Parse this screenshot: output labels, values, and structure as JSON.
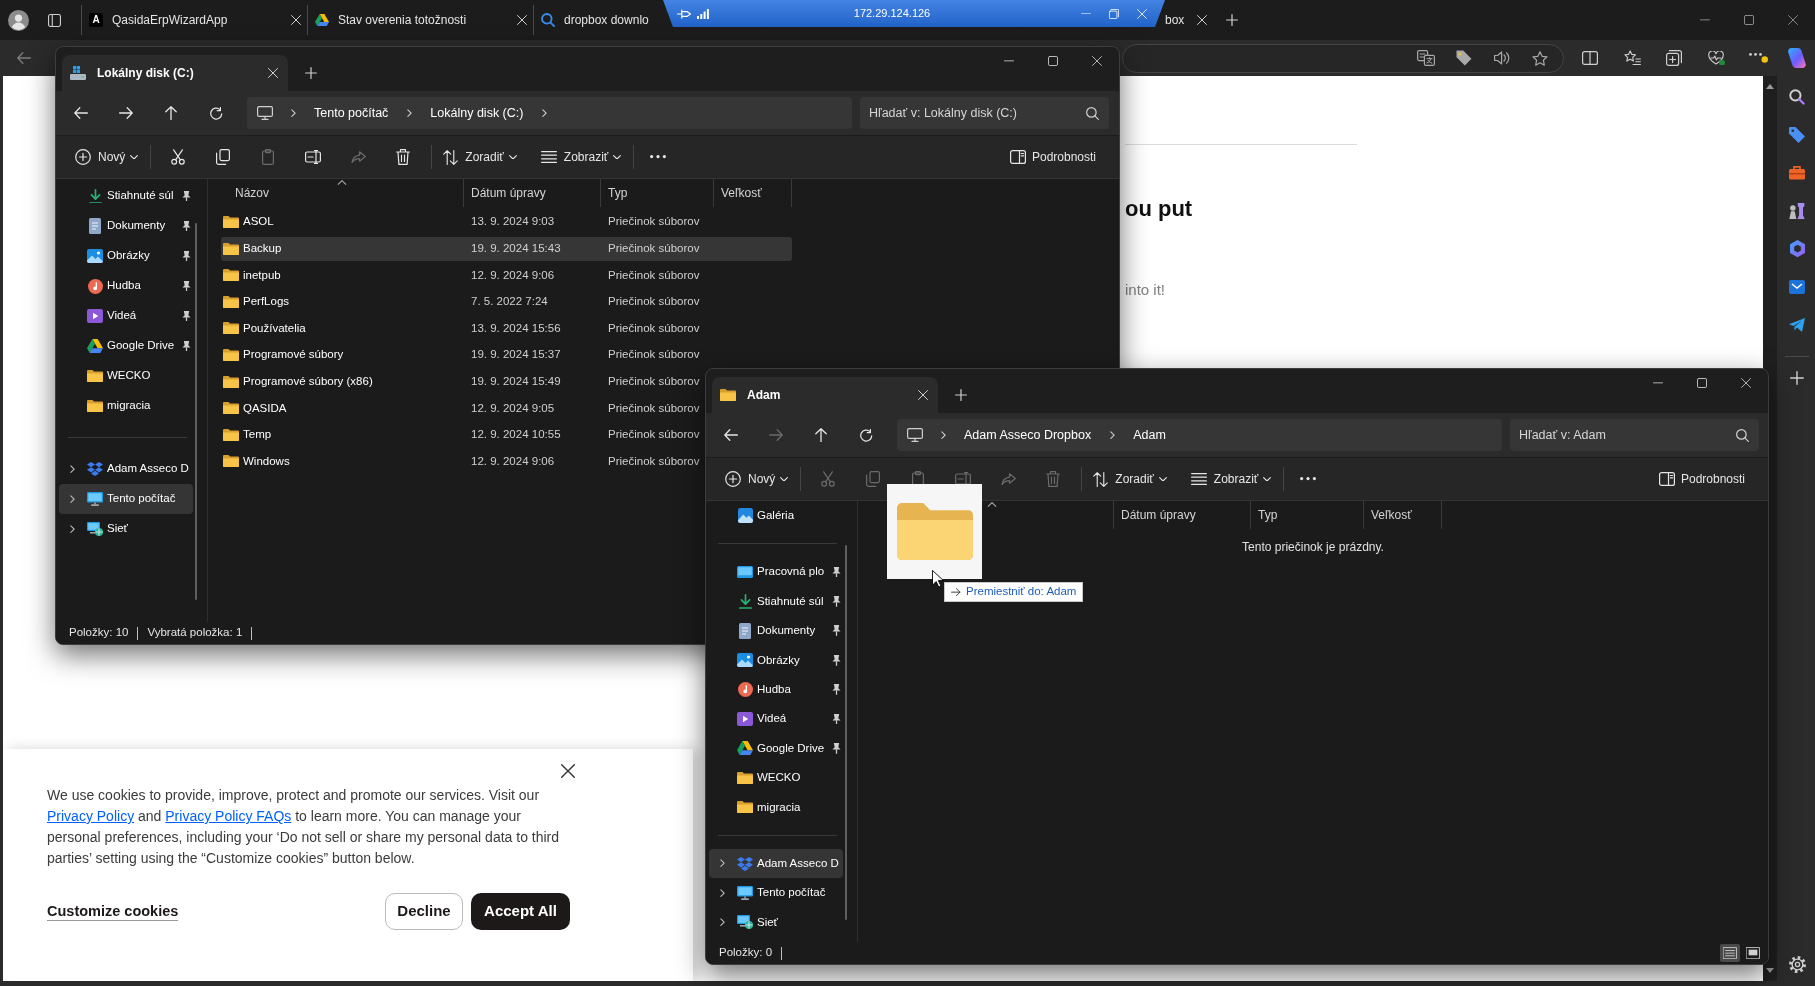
{
  "browser": {
    "tabs": [
      {
        "kind": "tab",
        "title": "QasidaErpWizardApp",
        "favicon": {
          "kind": "letter",
          "text": "A"
        }
      },
      {
        "kind": "tab",
        "title": "Stav overenia totožnosti",
        "favicon": {
          "kind": "google-drive"
        }
      },
      {
        "kind": "head",
        "title": "dropbox downlo",
        "favicon": {
          "kind": "search"
        }
      },
      {
        "kind": "tail",
        "title": "box"
      }
    ],
    "remote_bar": {
      "title": "172.29.124.126"
    },
    "page": {
      "heading": "ou put",
      "text": "into it!"
    },
    "cookie_banner": {
      "message": [
        {
          "kind": "text",
          "text": "We use cookies to provide, improve, protect and promote our services. Visit our "
        },
        {
          "kind": "link",
          "text": "Privacy Policy"
        },
        {
          "kind": "text",
          "text": " and "
        },
        {
          "kind": "link",
          "text": "Privacy Policy FAQs"
        },
        {
          "kind": "text",
          "text": " to learn more. You can manage your personal preferences, including your ‘Do not sell or share my personal data to third parties’ setting using the “Customize cookies” button below."
        }
      ],
      "customize": "Customize cookies",
      "decline": "Decline",
      "accept": "Accept All"
    }
  },
  "explorer_windows": [
    {
      "tab": {
        "title": "Lokálny disk (C:)",
        "kind": "drive"
      },
      "nav": [
        {
          "kind": "back",
          "disabled": false
        },
        {
          "kind": "forward",
          "disabled": false
        },
        {
          "kind": "up",
          "disabled": false
        },
        {
          "kind": "refresh",
          "disabled": false
        }
      ],
      "address": {
        "crumbs": [
          "Tento počítač",
          "Lokálny disk (C:)"
        ],
        "trailing_chevron": true
      },
      "search": {
        "placeholder": "Hľadať v: Lokálny disk (C:)"
      },
      "toolbar": [
        {
          "kind": "new",
          "label": "Nový",
          "disabled": false
        },
        {
          "kind": "cut",
          "disabled": false
        },
        {
          "kind": "copy",
          "disabled": false
        },
        {
          "kind": "paste",
          "disabled": true
        },
        {
          "kind": "rename",
          "disabled": false
        },
        {
          "kind": "share",
          "disabled": true
        },
        {
          "kind": "delete",
          "disabled": false
        },
        {
          "kind": "sort",
          "label": "Zoradiť",
          "disabled": false
        },
        {
          "kind": "view",
          "label": "Zobraziť",
          "disabled": false
        },
        {
          "kind": "more",
          "disabled": false
        },
        {
          "kind": "details",
          "label": "Podrobnosti",
          "disabled": false
        }
      ],
      "sidebar": [
        [
          {
            "label": "Stiahnuté súl",
            "kind": "download",
            "pinned": true,
            "selected": false
          },
          {
            "label": "Dokumenty",
            "kind": "documents",
            "pinned": true,
            "selected": false
          },
          {
            "label": "Obrázky",
            "kind": "pictures",
            "pinned": true,
            "selected": false
          },
          {
            "label": "Hudba",
            "kind": "music",
            "pinned": true,
            "selected": false
          },
          {
            "label": "Videá",
            "kind": "videos",
            "pinned": true,
            "selected": false
          },
          {
            "label": "Google Drive",
            "kind": "google-drive",
            "pinned": true,
            "selected": false
          },
          {
            "label": "WECKO",
            "kind": "folder",
            "pinned": false,
            "selected": false
          },
          {
            "label": "migracia",
            "kind": "folder",
            "pinned": false,
            "selected": false
          }
        ],
        [
          {
            "label": "Adam Asseco D",
            "kind": "dropbox",
            "expanded": false,
            "pinned": false,
            "selected": false
          },
          {
            "label": "Tento počítač",
            "kind": "computer",
            "expanded": false,
            "pinned": false,
            "selected": true
          },
          {
            "label": "Sieť",
            "kind": "network",
            "expanded": false,
            "pinned": false,
            "selected": false
          }
        ]
      ],
      "columns": [
        {
          "label": "Názov",
          "sorted": true
        },
        {
          "label": "Dátum úpravy",
          "sorted": false
        },
        {
          "label": "Typ",
          "sorted": false
        },
        {
          "label": "Veľkosť",
          "sorted": false
        }
      ],
      "rows": [
        {
          "name": "ASOL",
          "modified": "13. 9. 2024 9:03",
          "type": "Priečinok súborov",
          "selected": false
        },
        {
          "name": "Backup",
          "modified": "19. 9. 2024 15:43",
          "type": "Priečinok súborov",
          "selected": true
        },
        {
          "name": "inetpub",
          "modified": "12. 9. 2024 9:06",
          "type": "Priečinok súborov",
          "selected": false
        },
        {
          "name": "PerfLogs",
          "modified": "7. 5. 2022 7:24",
          "type": "Priečinok súborov",
          "selected": false
        },
        {
          "name": "Používatelia",
          "modified": "13. 9. 2024 15:56",
          "type": "Priečinok súborov",
          "selected": false
        },
        {
          "name": "Programové súbory",
          "modified": "19. 9. 2024 15:37",
          "type": "Priečinok súborov",
          "selected": false
        },
        {
          "name": "Programové súbory (x86)",
          "modified": "19. 9. 2024 15:49",
          "type": "Priečinok súborov",
          "selected": false
        },
        {
          "name": "QASIDA",
          "modified": "12. 9. 2024 9:05",
          "type": "Priečinok súborov",
          "selected": false
        },
        {
          "name": "Temp",
          "modified": "12. 9. 2024 10:55",
          "type": "Priečinok súborov",
          "selected": false
        },
        {
          "name": "Windows",
          "modified": "12. 9. 2024 9:06",
          "type": "Priečinok súborov",
          "selected": false
        }
      ],
      "status": [
        "Položky: 10",
        "Vybratá položka: 1"
      ]
    },
    {
      "tab": {
        "title": "Adam",
        "kind": "folder"
      },
      "nav": [
        {
          "kind": "back",
          "disabled": false
        },
        {
          "kind": "forward",
          "disabled": true
        },
        {
          "kind": "up",
          "disabled": false
        },
        {
          "kind": "refresh",
          "disabled": false
        }
      ],
      "address": {
        "crumbs": [
          "Adam Asseco Dropbox",
          "Adam"
        ],
        "trailing_chevron": false
      },
      "search": {
        "placeholder": "Hľadať v: Adam"
      },
      "toolbar": [
        {
          "kind": "new",
          "label": "Nový",
          "disabled": false
        },
        {
          "kind": "cut",
          "disabled": true
        },
        {
          "kind": "copy",
          "disabled": true
        },
        {
          "kind": "paste",
          "disabled": true
        },
        {
          "kind": "rename",
          "disabled": true
        },
        {
          "kind": "share",
          "disabled": true
        },
        {
          "kind": "delete",
          "disabled": true
        },
        {
          "kind": "sort",
          "label": "Zoradiť",
          "disabled": false
        },
        {
          "kind": "view",
          "label": "Zobraziť",
          "disabled": false
        },
        {
          "kind": "more",
          "disabled": false
        },
        {
          "kind": "details",
          "label": "Podrobnosti",
          "disabled": false
        }
      ],
      "sidebar": [
        [
          {
            "label": "Galéria",
            "kind": "gallery",
            "pinned": false,
            "selected": false
          }
        ],
        [
          {
            "label": "Pracovná plo",
            "kind": "desktop",
            "pinned": true,
            "selected": false
          },
          {
            "label": "Stiahnuté súl",
            "kind": "download",
            "pinned": true,
            "selected": false
          },
          {
            "label": "Dokumenty",
            "kind": "documents",
            "pinned": true,
            "selected": false
          },
          {
            "label": "Obrázky",
            "kind": "pictures",
            "pinned": true,
            "selected": false
          },
          {
            "label": "Hudba",
            "kind": "music",
            "pinned": true,
            "selected": false
          },
          {
            "label": "Videá",
            "kind": "videos",
            "pinned": true,
            "selected": false
          },
          {
            "label": "Google Drive",
            "kind": "google-drive",
            "pinned": true,
            "selected": false
          },
          {
            "label": "WECKO",
            "kind": "folder",
            "pinned": false,
            "selected": false
          },
          {
            "label": "migracia",
            "kind": "folder",
            "pinned": false,
            "selected": false
          }
        ],
        [
          {
            "label": "Adam Asseco D",
            "kind": "dropbox",
            "expanded": false,
            "pinned": false,
            "selected": true
          },
          {
            "label": "Tento počítač",
            "kind": "computer",
            "expanded": false,
            "pinned": false,
            "selected": false
          },
          {
            "label": "Sieť",
            "kind": "network",
            "expanded": false,
            "pinned": false,
            "selected": false
          }
        ]
      ],
      "columns": [
        {
          "sorted": true
        },
        {
          "label": "Dátum úpravy",
          "sorted": false
        },
        {
          "label": "Typ",
          "sorted": false
        },
        {
          "label": "Veľkosť",
          "sorted": false
        }
      ],
      "empty_message": "Tento priečinok je prázdny.",
      "status": [
        "Položky: 0"
      ],
      "view_modes": [
        {
          "kind": "details",
          "selected": true
        },
        {
          "kind": "tiles",
          "selected": false
        }
      ],
      "drag": {
        "tooltip": "Premiestniť do: Adam"
      }
    }
  ]
}
